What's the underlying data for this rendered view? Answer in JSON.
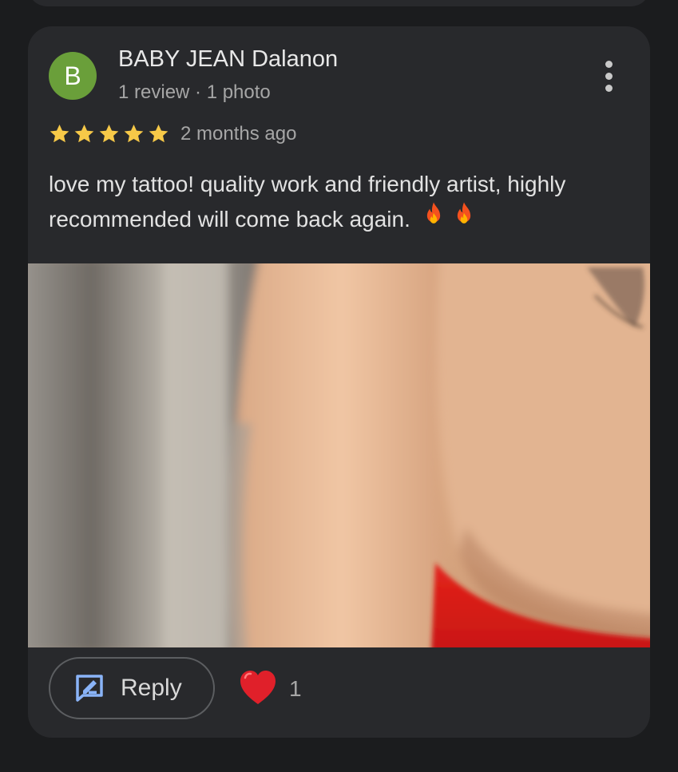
{
  "review": {
    "author_initial": "B",
    "author_name": "BABY JEAN Dalanon",
    "author_meta": "1 review · 1 photo",
    "rating": 5,
    "time_ago": "2 months ago",
    "text": "love my tattoo! quality work and friendly artist, highly recommended will come back again.",
    "text_emojis": [
      "fire-icon",
      "fire-icon"
    ],
    "has_photo": true,
    "like_count": "1"
  },
  "actions": {
    "reply_label": "Reply",
    "more_icon": "more-vert-icon",
    "like_icon": "heart-icon",
    "reply_icon": "rate-review-icon"
  },
  "colors": {
    "background": "#1b1c1e",
    "card": "#28292c",
    "avatar": "#6a9f3a",
    "star": "#f7c948",
    "reply_icon": "#8ab4f8",
    "heart": "#e0202a",
    "secondary_text": "#a6a6a6"
  }
}
